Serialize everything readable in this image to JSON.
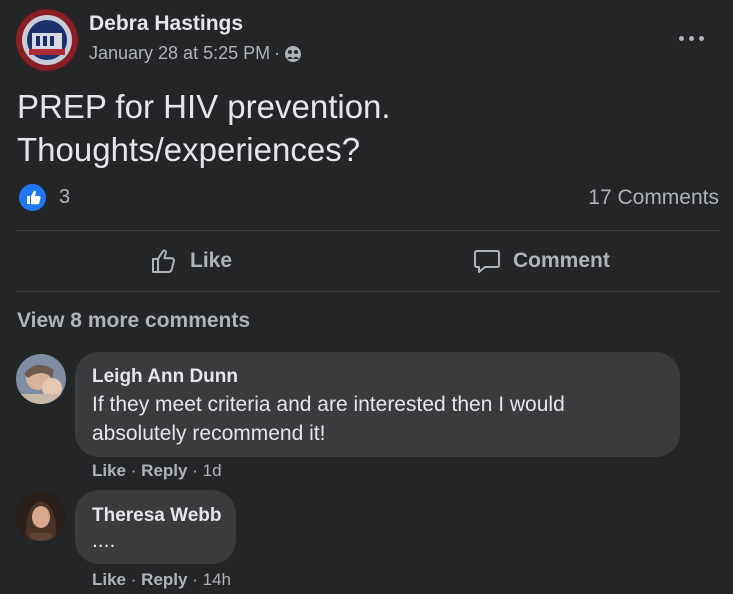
{
  "post": {
    "author": "Debra Hastings",
    "timestamp": "January 28 at 5:25 PM",
    "separator": "·",
    "audience_icon": "friends-icon",
    "more_icon": "more-options-icon",
    "text_line1": "PREP for HIV prevention.",
    "text_line2": "Thoughts/experiences?",
    "reaction_count": "3",
    "comments_count": "17 Comments"
  },
  "actions": {
    "like_label": "Like",
    "comment_label": "Comment"
  },
  "view_more": "View 8 more comments",
  "comments": [
    {
      "name": "Leigh Ann Dunn",
      "text_line1": "If they meet criteria and are interested then I would",
      "text_line2": "absolutely recommend it!",
      "like": "Like",
      "sep1": "·",
      "reply": "Reply",
      "sep2": "·",
      "time": "1d"
    },
    {
      "name": "Theresa Webb",
      "text_line1": "....",
      "like": "Like",
      "sep1": "·",
      "reply": "Reply",
      "sep2": "·",
      "time": "14h"
    }
  ],
  "colors": {
    "background": "#242526",
    "bubble": "#3a3b3c",
    "accent": "#2078f4",
    "secondary_text": "#b0b3b8"
  }
}
